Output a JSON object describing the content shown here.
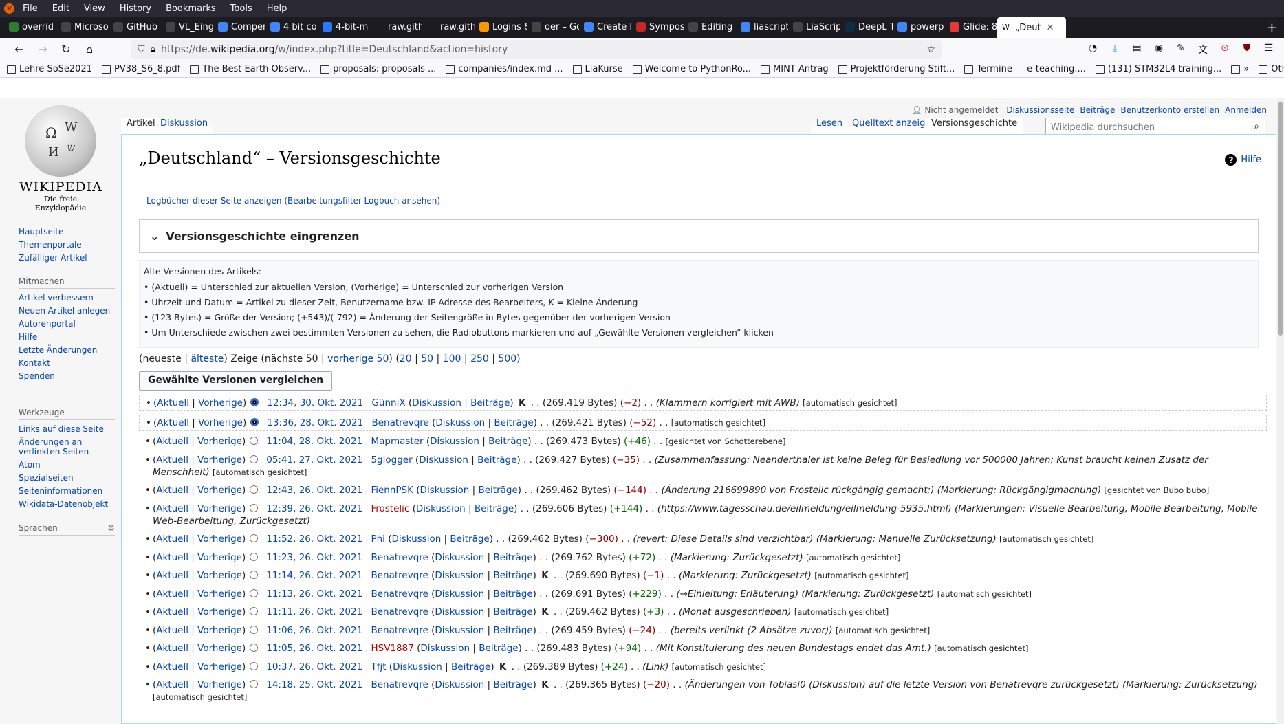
{
  "browser": {
    "menu": [
      "File",
      "Edit",
      "View",
      "History",
      "Bookmarks",
      "Tools",
      "Help"
    ],
    "tabs": [
      {
        "label": "overrid",
        "color": "#2e7d32"
      },
      {
        "label": "Microso",
        "color": "#444"
      },
      {
        "label": "GitHub",
        "color": "#444"
      },
      {
        "label": "VL_Eing",
        "color": "#444"
      },
      {
        "label": "Compen",
        "color": "#4285f4"
      },
      {
        "label": "4 bit co",
        "color": "#4285f4"
      },
      {
        "label": "4-bit-m",
        "color": "#2979ff"
      },
      {
        "label": "raw.githubu",
        "color": "#1c1b22"
      },
      {
        "label": "raw.githubu",
        "color": "#1c1b22"
      },
      {
        "label": "Logins &",
        "color": "#ff9800"
      },
      {
        "label": "oer – Go",
        "color": "#444"
      },
      {
        "label": "Create E",
        "color": "#4285f4"
      },
      {
        "label": "Sympos",
        "color": "#c62828"
      },
      {
        "label": "Editing",
        "color": "#444"
      },
      {
        "label": "liascript",
        "color": "#4285f4"
      },
      {
        "label": "LiaScrip",
        "color": "#444"
      },
      {
        "label": "DeepL T",
        "color": "#0f2b46"
      },
      {
        "label": "powerp",
        "color": "#4285f4"
      },
      {
        "label": "Glide: 8",
        "color": "#e53935"
      },
      {
        "label": "„Deut",
        "color": "#fff",
        "active": true
      }
    ],
    "url_prefix": "https://de.",
    "url_domain": "wikipedia.org",
    "url_rest": "/w/index.php?title=Deutschland&action=history",
    "bookmarks": [
      "Lehre SoSe2021",
      "PV38_S6_8.pdf",
      "The Best Earth Observ...",
      "proposals: proposals ...",
      "companies/index.md ...",
      "LiaKurse",
      "Welcome to PythonRo...",
      "MINT Antrag",
      "Projektförderung Stift...",
      "Termine — e-teaching....",
      "(131) STM32L4 training...",
      "»",
      "Other Bookmarks"
    ]
  },
  "wiki": {
    "logo_title": "WIKIPEDIA",
    "logo_sub": "Die freie Enzyklopädie",
    "nav_main": [
      "Hauptseite",
      "Themenportale",
      "Zufälliger Artikel"
    ],
    "mitmachen_title": "Mitmachen",
    "mitmachen": [
      "Artikel verbessern",
      "Neuen Artikel anlegen",
      "Autorenportal",
      "Hilfe",
      "Letzte Änderungen",
      "Kontakt",
      "Spenden"
    ],
    "werkzeuge_title": "Werkzeuge",
    "werkzeuge": [
      "Links auf diese Seite",
      "Änderungen an verlinkten Seiten",
      "Atom",
      "Spezialseiten",
      "Seiteninformationen",
      "Wikidata-Datenobjekt"
    ],
    "sprachen": "Sprachen",
    "personal": {
      "status": "Nicht angemeldet",
      "links": [
        "Diskussionsseite",
        "Beiträge",
        "Benutzerkonto erstellen",
        "Anmelden"
      ]
    },
    "tabs_left": [
      "Artikel",
      "Diskussion"
    ],
    "tabs_right": [
      "Lesen",
      "Quelltext anzeigen",
      "Versionsgeschichte"
    ],
    "search_placeholder": "Wikipedia durchsuchen",
    "title": "„Deutschland“ – Versionsgeschichte",
    "help": "Hilfe",
    "logs_a": "Logbücher dieser Seite anzeigen",
    "logs_b": "Bearbeitungsfilter-Logbuch ansehen",
    "filter": "Versionsgeschichte eingrenzen",
    "legend_title": "Alte Versionen des Artikels:",
    "legend": [
      "(Aktuell) = Unterschied zur aktuellen Version, (Vorherige) = Unterschied zur vorherigen Version",
      "Uhrzeit und Datum = Artikel zu dieser Zeit, Benutzername bzw. IP-Adresse des Bearbeiters, K = Kleine Änderung",
      "(123 Bytes) = Größe der Version; (+543)/(-792) = Änderung der Seitengröße in Bytes gegenüber der vorherigen Version",
      "Um Unterschiede zwischen zwei bestimmten Versionen zu sehen, die Radiobuttons markieren und auf „Gewählte Versionen vergleichen“ klicken"
    ],
    "pager": {
      "neueste": "(neueste |",
      "aelteste": "älteste",
      "zeige": ") Zeige (nächste 50 |",
      "vorherige": "vorherige 50",
      "counts": [
        "20",
        "50",
        "100",
        "250",
        "500"
      ]
    },
    "compare_button": "Gewählte Versionen vergleichen",
    "rows": [
      {
        "date": "12:34, 30. Okt. 2021",
        "user": "GünniX",
        "minor": true,
        "size": "(269.419 Bytes)",
        "diff": "(−2)",
        "neg": true,
        "comment": "(Klammern korrigiert mit AWB)",
        "tag": "[automatisch gesichtet]",
        "radio": "on",
        "sel": true
      },
      {
        "date": "13:36, 28. Okt. 2021",
        "user": "Benatrevqre",
        "minor": false,
        "size": "(269.421 Bytes)",
        "diff": "(−52)",
        "neg": true,
        "comment": "",
        "tag": "[automatisch gesichtet]",
        "radio": "on",
        "sel": true
      },
      {
        "date": "11:04, 28. Okt. 2021",
        "user": "Mapmaster",
        "minor": false,
        "size": "(269.473 Bytes)",
        "diff": "(+46)",
        "neg": false,
        "comment": "",
        "tag": "[gesichtet von Schotterebene]",
        "radio": "off"
      },
      {
        "date": "05:41, 27. Okt. 2021",
        "user": "5glogger",
        "minor": false,
        "size": "(269.427 Bytes)",
        "diff": "(−35)",
        "neg": true,
        "comment": "(Zusammenfassung: Neanderthaler ist keine Beleg für Besiedlung vor 500000 Jahren; Kunst braucht keinen Zusatz der Menschheit)",
        "tag": "[automatisch gesichtet]",
        "radio": "off"
      },
      {
        "date": "12:43, 26. Okt. 2021",
        "user": "FiennPSK",
        "minor": false,
        "size": "(269.462 Bytes)",
        "diff": "(−144)",
        "neg": true,
        "comment": "(Änderung 216699890 von Frostelic rückgängig gemacht;) (Markierung: Rückgängigmachung)",
        "tag": "[gesichtet von Bubo bubo]",
        "radio": "off"
      },
      {
        "date": "12:39, 26. Okt. 2021",
        "user": "Frostelic",
        "red": true,
        "minor": false,
        "size": "(269.606 Bytes)",
        "diff": "(+144)",
        "neg": false,
        "comment": "(https://www.tagesschau.de/eilmeldung/eilmeldung-5935.html) (Markierungen: Visuelle Bearbeitung, Mobile Bearbeitung, Mobile Web-Bearbeitung, Zurückgesetzt)",
        "tag": "",
        "radio": "off"
      },
      {
        "date": "11:52, 26. Okt. 2021",
        "user": "Phi",
        "minor": false,
        "size": "(269.462 Bytes)",
        "diff": "(−300)",
        "neg": true,
        "comment": "(revert: Diese Details sind verzichtbar) (Markierung: Manuelle Zurücksetzung)",
        "tag": "[automatisch gesichtet]",
        "radio": "off"
      },
      {
        "date": "11:23, 26. Okt. 2021",
        "user": "Benatrevqre",
        "minor": false,
        "size": "(269.762 Bytes)",
        "diff": "(+72)",
        "neg": false,
        "comment": "(Markierung: Zurückgesetzt)",
        "tag": "[automatisch gesichtet]",
        "radio": "off"
      },
      {
        "date": "11:14, 26. Okt. 2021",
        "user": "Benatrevqre",
        "minor": true,
        "size": "(269.690 Bytes)",
        "diff": "(−1)",
        "neg": true,
        "comment": "(Markierung: Zurückgesetzt)",
        "tag": "[automatisch gesichtet]",
        "radio": "off"
      },
      {
        "date": "11:13, 26. Okt. 2021",
        "user": "Benatrevqre",
        "minor": false,
        "size": "(269.691 Bytes)",
        "diff": "(+229)",
        "neg": false,
        "comment": "(→Einleitung: Erläuterung) (Markierung: Zurückgesetzt)",
        "tag": "[automatisch gesichtet]",
        "radio": "off"
      },
      {
        "date": "11:11, 26. Okt. 2021",
        "user": "Benatrevqre",
        "minor": true,
        "size": "(269.462 Bytes)",
        "diff": "(+3)",
        "neg": false,
        "comment": "(Monat ausgeschrieben)",
        "tag": "[automatisch gesichtet]",
        "radio": "off"
      },
      {
        "date": "11:06, 26. Okt. 2021",
        "user": "Benatrevqre",
        "minor": false,
        "size": "(269.459 Bytes)",
        "diff": "(−24)",
        "neg": true,
        "comment": "(bereits verlinkt (2 Absätze zuvor))",
        "tag": "[automatisch gesichtet]",
        "radio": "off"
      },
      {
        "date": "11:05, 26. Okt. 2021",
        "user": "HSV1887",
        "red": true,
        "minor": false,
        "size": "(269.483 Bytes)",
        "diff": "(+94)",
        "neg": false,
        "comment": "(Mit Konstituierung des neuen Bundestags endet das Amt.)",
        "tag": "[automatisch gesichtet]",
        "radio": "off"
      },
      {
        "date": "10:37, 26. Okt. 2021",
        "user": "Tfjt",
        "minor": true,
        "size": "(269.389 Bytes)",
        "diff": "(+24)",
        "neg": false,
        "comment": "(Link)",
        "tag": "[automatisch gesichtet]",
        "radio": "off"
      },
      {
        "date": "14:18, 25. Okt. 2021",
        "user": "Benatrevqre",
        "minor": true,
        "size": "(269.365 Bytes)",
        "diff": "(−20)",
        "neg": true,
        "comment": "(Änderungen von Tobiasi0 (Diskussion) auf die letzte Version von Benatrevqre zurückgesetzt) (Markierung: Zurücksetzung)",
        "tag": "[automatisch gesichtet]",
        "radio": "off"
      }
    ],
    "labels": {
      "aktuell": "Aktuell",
      "vorherige": "Vorherige",
      "diskussion": "Diskussion",
      "beitraege": "Beiträge",
      "minor": "K"
    }
  }
}
